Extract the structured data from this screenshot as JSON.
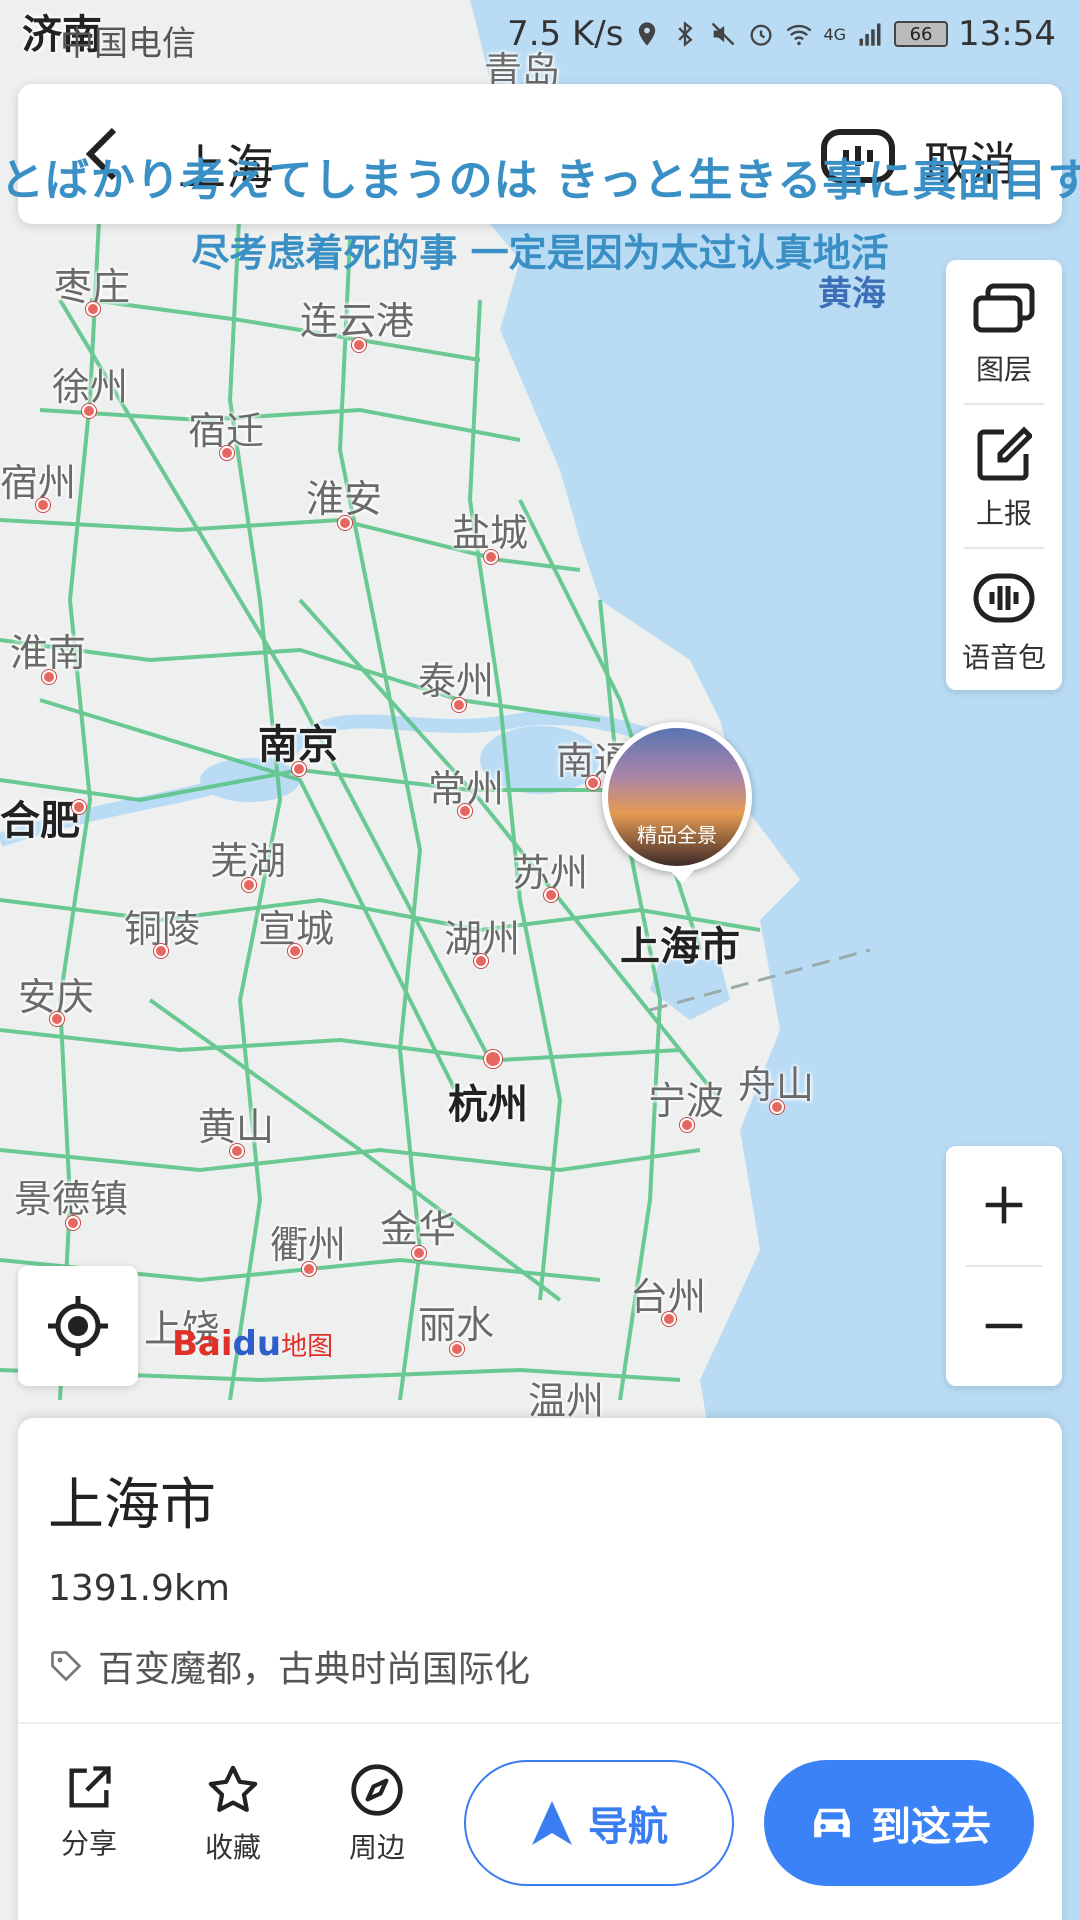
{
  "status_bar": {
    "carrier": "中国电信",
    "speed": "7.5 K/s",
    "network": "4G",
    "battery": "66",
    "time": "13:54"
  },
  "search": {
    "query": "上海",
    "cancel_label": "取消"
  },
  "subtitles": {
    "japanese": "とばかり考えてしまうのは きっと生きる事に真面目す",
    "chinese": "尽考虑着死的事 一定是因为太过认真地活"
  },
  "tools": {
    "layers": "图层",
    "report": "上报",
    "voice_pack": "语音包"
  },
  "zoom": {
    "in": "+",
    "out": "−"
  },
  "map": {
    "sea_label": "黄海",
    "cities": [
      {
        "name": "济南",
        "major": true
      },
      {
        "name": "青岛",
        "major": false
      },
      {
        "name": "枣庄",
        "major": false
      },
      {
        "name": "连云港",
        "major": false
      },
      {
        "name": "徐州",
        "major": false
      },
      {
        "name": "宿迁",
        "major": false
      },
      {
        "name": "宿州",
        "major": false
      },
      {
        "name": "淮安",
        "major": false
      },
      {
        "name": "盐城",
        "major": false
      },
      {
        "name": "淮南",
        "major": false
      },
      {
        "name": "泰州",
        "major": false
      },
      {
        "name": "南京",
        "major": true
      },
      {
        "name": "南通",
        "major": false
      },
      {
        "name": "常州",
        "major": false
      },
      {
        "name": "合肥",
        "major": true
      },
      {
        "name": "芜湖",
        "major": false
      },
      {
        "name": "苏州",
        "major": false
      },
      {
        "name": "铜陵",
        "major": false
      },
      {
        "name": "宣城",
        "major": false
      },
      {
        "name": "湖州",
        "major": false
      },
      {
        "name": "上海市",
        "major": true
      },
      {
        "name": "安庆",
        "major": false
      },
      {
        "name": "杭州",
        "major": true
      },
      {
        "name": "宁波",
        "major": false
      },
      {
        "name": "舟山",
        "major": false
      },
      {
        "name": "黄山",
        "major": false
      },
      {
        "name": "景德镇",
        "major": false
      },
      {
        "name": "金华",
        "major": false
      },
      {
        "name": "衢州",
        "major": false
      },
      {
        "name": "台州",
        "major": false
      },
      {
        "name": "上饶",
        "major": false
      },
      {
        "name": "丽水",
        "major": false
      },
      {
        "name": "温州",
        "major": false
      }
    ]
  },
  "panorama": {
    "label": "精品全景"
  },
  "logo": {
    "text1": "Bai",
    "text2": "du",
    "text3": "地图"
  },
  "card": {
    "title": "上海市",
    "distance": "1391.9km",
    "tagline": "百变魔都，古典时尚国际化",
    "actions": {
      "share": "分享",
      "favorite": "收藏",
      "nearby": "周边"
    },
    "navigate_label": "导航",
    "go_label": "到这去"
  },
  "colors": {
    "sea": "#b9dcf4",
    "land": "#eef0ef",
    "road": "#5cc48a",
    "accent": "#3b82f6"
  }
}
